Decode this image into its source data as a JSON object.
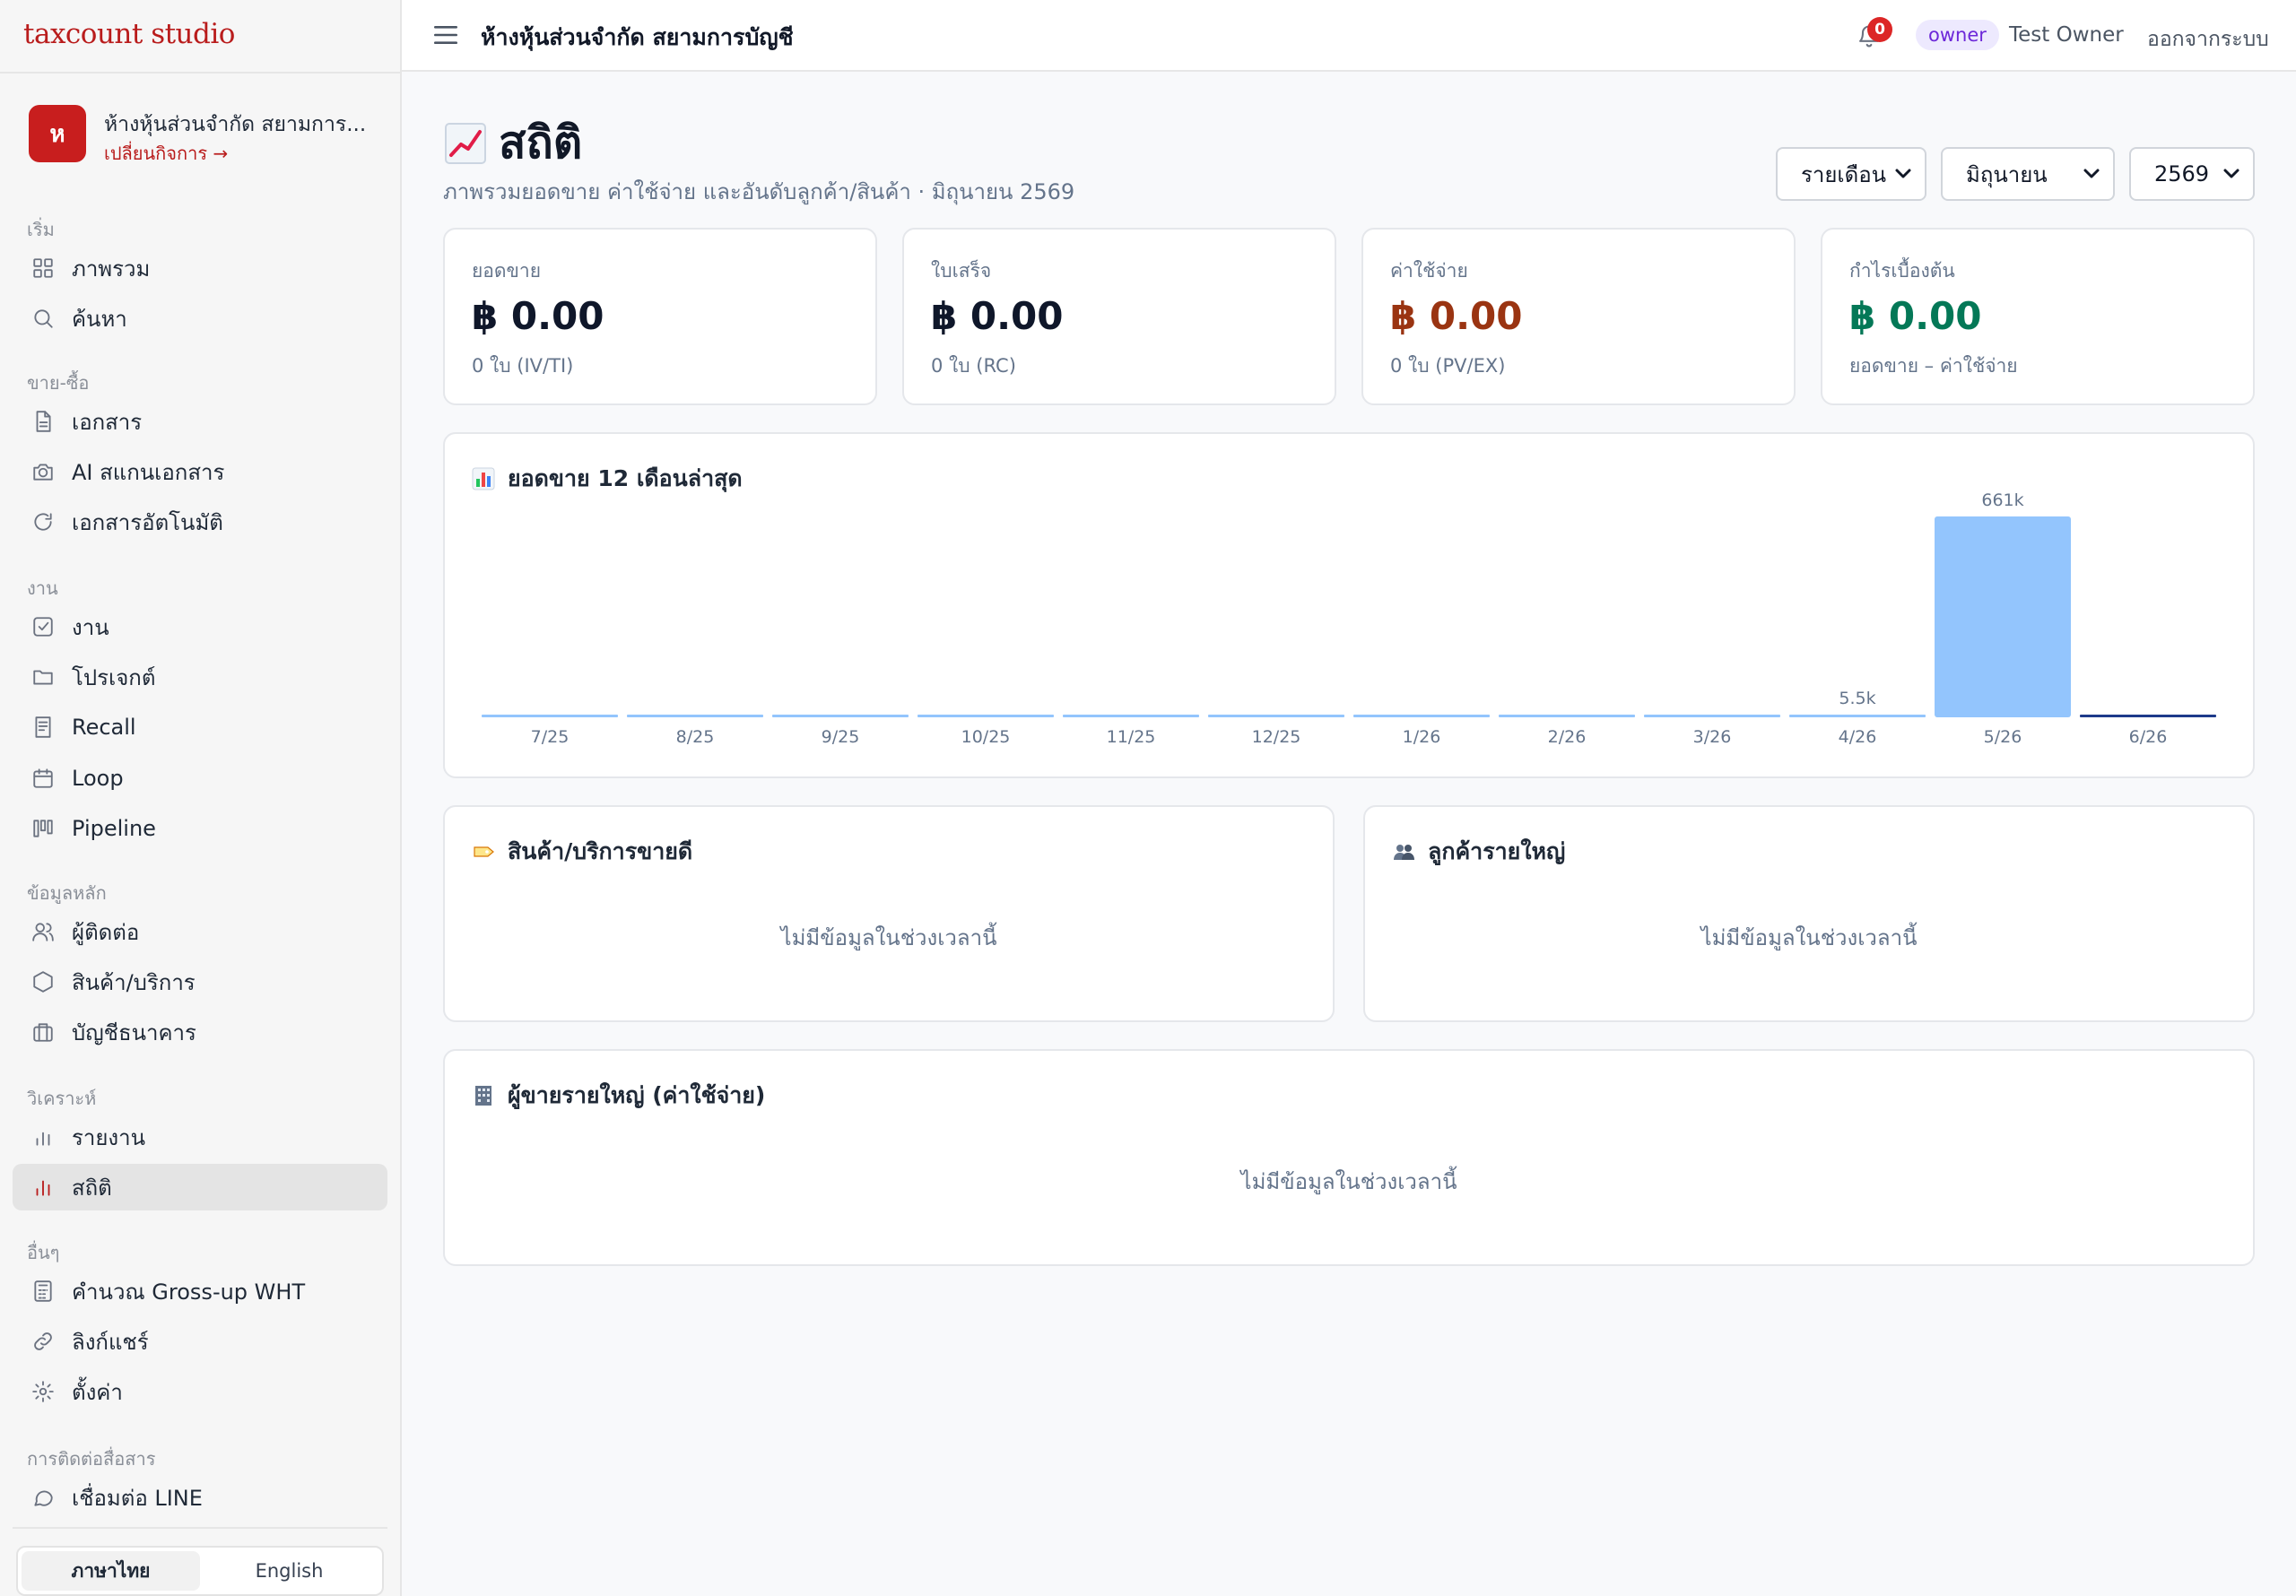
{
  "app": {
    "logo": "taxcount studio",
    "business_initial": "ห",
    "business_name": "ห้างหุ้นส่วนจำกัด สยามการบัญชี",
    "business_name_short": "ห้างหุ้นส่วนจำกัด สยามการ...",
    "switch_label": "เปลี่ยนกิจการ →"
  },
  "sidebar": {
    "sections": [
      {
        "title": "เริ่ม",
        "items": [
          {
            "label": "ภาพรวม",
            "icon": "grid-icon"
          },
          {
            "label": "ค้นหา",
            "icon": "search-icon"
          }
        ]
      },
      {
        "title": "ขาย-ซื้อ",
        "items": [
          {
            "label": "เอกสาร",
            "icon": "document-icon"
          },
          {
            "label": "AI สแกนเอกสาร",
            "icon": "camera-icon"
          },
          {
            "label": "เอกสารอัตโนมัติ",
            "icon": "refresh-icon"
          }
        ]
      },
      {
        "title": "งาน",
        "items": [
          {
            "label": "งาน",
            "icon": "checkbox-icon"
          },
          {
            "label": "โปรเจกต์",
            "icon": "folder-icon"
          },
          {
            "label": "Recall",
            "icon": "receipt-icon"
          },
          {
            "label": "Loop",
            "icon": "calendar-icon"
          },
          {
            "label": "Pipeline",
            "icon": "kanban-icon"
          }
        ]
      },
      {
        "title": "ข้อมูลหลัก",
        "items": [
          {
            "label": "ผู้ติดต่อ",
            "icon": "users-icon"
          },
          {
            "label": "สินค้า/บริการ",
            "icon": "box-icon"
          },
          {
            "label": "บัญชีธนาคาร",
            "icon": "bank-icon"
          }
        ]
      },
      {
        "title": "วิเคราะห์",
        "items": [
          {
            "label": "รายงาน",
            "icon": "bar-chart-icon"
          },
          {
            "label": "สถิติ",
            "icon": "stats-icon",
            "active": true
          }
        ]
      },
      {
        "title": "อื่นๆ",
        "items": [
          {
            "label": "คำนวณ Gross-up WHT",
            "icon": "calculator-icon"
          },
          {
            "label": "ลิงก์แชร์",
            "icon": "link-icon"
          },
          {
            "label": "ตั้งค่า",
            "icon": "gear-icon"
          }
        ]
      },
      {
        "title": "การติดต่อสื่อสาร",
        "items": [
          {
            "label": "เชื่อมต่อ LINE",
            "icon": "chat-icon"
          }
        ]
      }
    ],
    "languages": [
      {
        "label": "ภาษาไทย",
        "active": true
      },
      {
        "label": "English",
        "active": false
      }
    ]
  },
  "topbar": {
    "title": "ห้างหุ้นส่วนจำกัด สยามการบัญชี",
    "notification_count": "0",
    "role": "owner",
    "user_name": "Test Owner",
    "logout_label": "ออกจากระบบ"
  },
  "page": {
    "title": "สถิติ",
    "title_icon": "chart-increasing-emoji",
    "subtitle": "ภาพรวมยอดขาย ค่าใช้จ่าย และอันดับลูกค้า/สินค้า · มิถุนายน 2569",
    "filters": {
      "period": "รายเดือน",
      "month": "มิถุนายน",
      "year": "2569"
    }
  },
  "kpis": [
    {
      "label": "ยอดขาย",
      "value": "฿ 0.00",
      "sub": "0 ใบ (IV/TI)",
      "color": "#0f172a"
    },
    {
      "label": "ใบเสร็จ",
      "value": "฿ 0.00",
      "sub": "0 ใบ (RC)",
      "color": "#0f172a"
    },
    {
      "label": "ค่าใช้จ่าย",
      "value": "฿ 0.00",
      "sub": "0 ใบ (PV/EX)",
      "color": "#9a3412"
    },
    {
      "label": "กำไรเบื้องต้น",
      "value": "฿ 0.00",
      "sub": "ยอดขาย – ค่าใช้จ่าย",
      "color": "#047857"
    }
  ],
  "sales_chart": {
    "title": "ยอดขาย 12 เดือนล่าสุด",
    "title_icon": "bar-chart-emoji"
  },
  "chart_data": {
    "type": "bar",
    "title": "ยอดขาย 12 เดือนล่าสุด",
    "categories": [
      "7/25",
      "8/25",
      "9/25",
      "10/25",
      "11/25",
      "12/25",
      "1/26",
      "2/26",
      "3/26",
      "4/26",
      "5/26",
      "6/26"
    ],
    "values": [
      0,
      0,
      0,
      0,
      0,
      0,
      0,
      0,
      0,
      5500,
      661000,
      0
    ],
    "data_labels": [
      "",
      "",
      "",
      "",
      "",
      "",
      "",
      "",
      "",
      "5.5k",
      "661k",
      ""
    ],
    "highlight_category": "6/26",
    "bar_color": "#93c5fd",
    "highlight_color": "#1e3a8a",
    "ylim": [
      0,
      661000
    ],
    "grid": false
  },
  "top_products": {
    "title": "สินค้า/บริการขายดี",
    "title_icon": "label-emoji",
    "empty": "ไม่มีข้อมูลในช่วงเวลานี้"
  },
  "top_customers": {
    "title": "ลูกค้ารายใหญ่",
    "title_icon": "people-emoji",
    "empty": "ไม่มีข้อมูลในช่วงเวลานี้"
  },
  "top_vendors": {
    "title": "ผู้ขายรายใหญ่ (ค่าใช้จ่าย)",
    "title_icon": "office-building-emoji",
    "empty": "ไม่มีข้อมูลในช่วงเวลานี้"
  }
}
